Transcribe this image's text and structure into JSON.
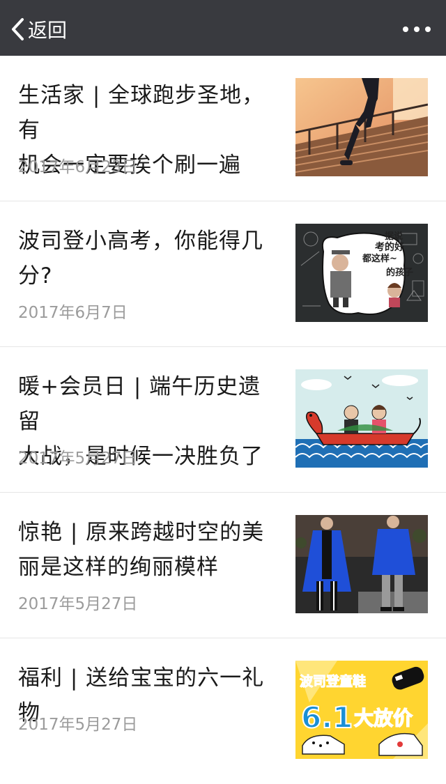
{
  "header": {
    "back_label": "返回"
  },
  "articles": [
    {
      "title_line1": "生活家 | 全球跑步圣地，有",
      "title_line2": "机会一定要挨个刷一遍",
      "date": "2017年6月23日",
      "image": "running-stairs"
    },
    {
      "title_line1": "波司登小高考，你能得几",
      "title_line2": "分?",
      "date": "2017年6月7日",
      "image": "chalkboard-exam",
      "image_text": "据说考的好的孩子都这样~"
    },
    {
      "title_line1": "暖+会员日 | 端午历史遗留",
      "title_line2": "大战，是时候一决胜负了",
      "date": "2017年5月27日",
      "image": "dragon-boat"
    },
    {
      "title_line1": "惊艳 | 原来跨越时空的美",
      "title_line2": "丽是这样的绚丽模样",
      "date": "2017年5月27日",
      "image": "fashion-runway"
    },
    {
      "title_line1": "福利 | 送给宝宝的六一礼物",
      "title_line2": "",
      "date": "2017年5月27日",
      "image": "kids-shoes-promo",
      "image_text_top": "波司登童鞋",
      "image_text_big": "6.1",
      "image_text_big2": "大放价"
    }
  ]
}
